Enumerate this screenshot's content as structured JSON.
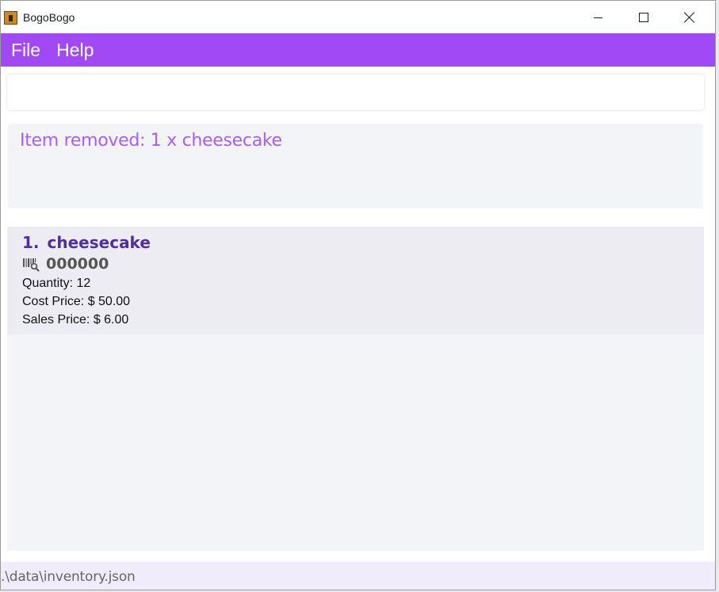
{
  "window": {
    "title": "BogoBogo",
    "controls": {
      "minimize": "minimize",
      "maximize": "maximize",
      "close": "close"
    }
  },
  "menu": {
    "items": [
      {
        "label": "File"
      },
      {
        "label": "Help"
      }
    ]
  },
  "command": {
    "value": "",
    "placeholder": ""
  },
  "result": {
    "message": "Item removed: 1 x cheesecake"
  },
  "items": [
    {
      "index": "1.",
      "name": "cheesecake",
      "barcode": "000000",
      "barcode_icon": "barcode-scan-icon",
      "quantity": "Quantity: 12",
      "cost_price": "Cost Price: $ 50.00",
      "sales_price": "Sales Price: $ 6.00"
    }
  ],
  "status": {
    "file_path": ".\\data\\inventory.json"
  },
  "colors": {
    "accent": "#a149f5",
    "result_text": "#a95ef4",
    "item_name": "#4f2f9e",
    "panel_bg": "#f3f4f8"
  }
}
